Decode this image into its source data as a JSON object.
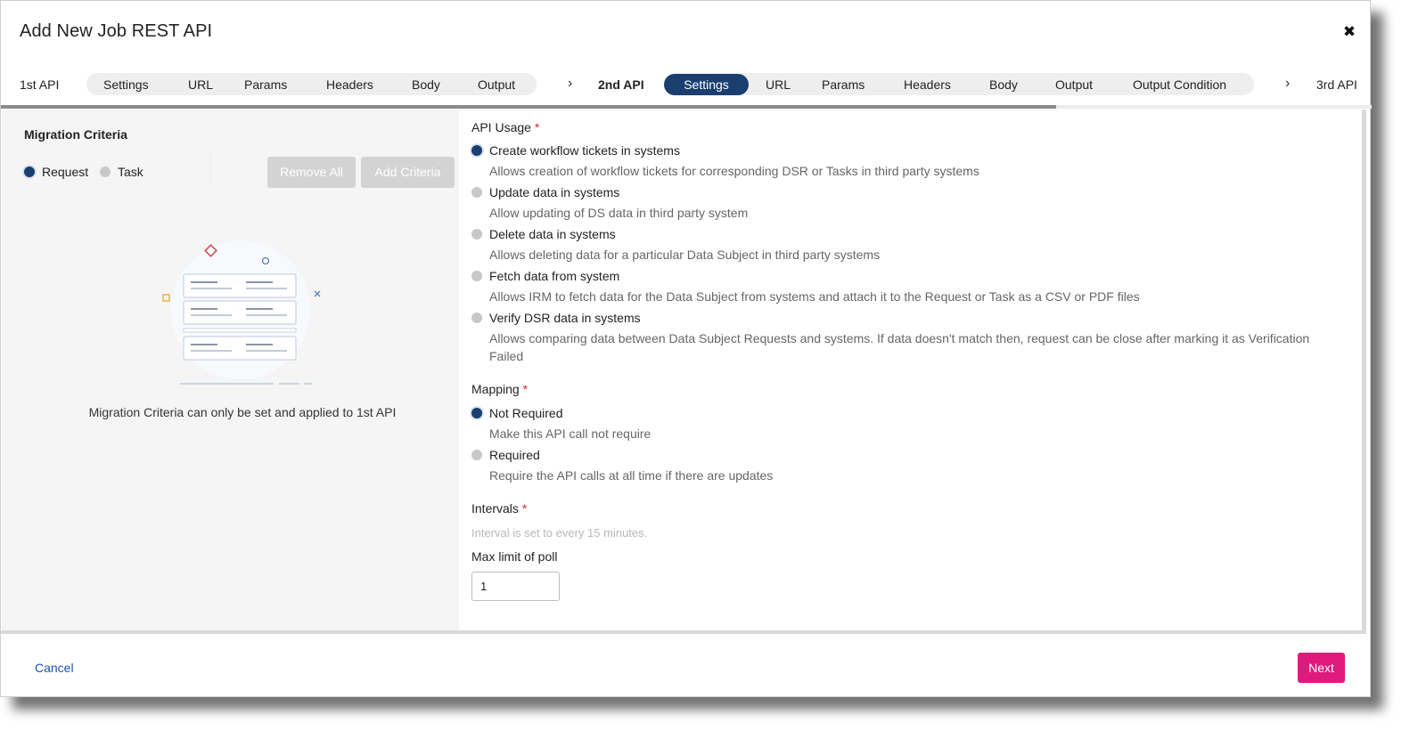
{
  "dialog": {
    "title": "Add New Job REST API"
  },
  "steps": {
    "api1": {
      "label": "1st API",
      "tabs": [
        "Settings",
        "URL",
        "Params",
        "Headers",
        "Body",
        "Output"
      ]
    },
    "api2": {
      "label": "2nd API",
      "active_tab": "Settings",
      "tabs": [
        "URL",
        "Params",
        "Headers",
        "Body",
        "Output",
        "Output Condition"
      ]
    },
    "api3": {
      "label": "3rd API"
    },
    "progress_fraction": 0.77
  },
  "migration": {
    "title": "Migration Criteria",
    "options": [
      "Request",
      "Task"
    ],
    "selected": "Request",
    "remove_all": "Remove All",
    "add_criteria": "Add Criteria",
    "empty_message": "Migration Criteria can only be set and applied to 1st API"
  },
  "api_usage": {
    "label": "API Usage",
    "required_mark": "*",
    "selected_index": 0,
    "options": [
      {
        "title": "Create workflow tickets in systems",
        "desc": "Allows creation of workflow tickets for corresponding DSR or Tasks in third party systems"
      },
      {
        "title": "Update data in systems",
        "desc": "Allow updating of DS data in third party system"
      },
      {
        "title": "Delete data in systems",
        "desc": "Allows deleting data for a particular Data Subject in third party systems"
      },
      {
        "title": "Fetch data from system",
        "desc": "Allows IRM to fetch data for the Data Subject from systems and attach it to the Request or Task as a CSV or PDF files"
      },
      {
        "title": "Verify DSR data in systems",
        "desc": "Allows comparing data between Data Subject Requests and systems. If data doesn't match then, request can be close after marking it as Verification Failed"
      }
    ]
  },
  "mapping": {
    "label": "Mapping",
    "required_mark": "*",
    "selected_index": 0,
    "options": [
      {
        "title": "Not Required",
        "desc": "Make this API call not require"
      },
      {
        "title": "Required",
        "desc": "Require the API calls at all time if there are updates"
      }
    ]
  },
  "intervals": {
    "label": "Intervals",
    "required_mark": "*",
    "hint": "Interval is set to every 15 minutes."
  },
  "max_poll": {
    "label": "Max limit of poll",
    "value": "1"
  },
  "footer": {
    "cancel": "Cancel",
    "next": "Next"
  },
  "colors": {
    "primary": "#1a3f6e",
    "accent": "#df1a7c",
    "link": "#1a52b7",
    "required": "#d12b2b"
  },
  "icons": {
    "close": "close-icon",
    "chevron": "chevron-right-icon"
  }
}
